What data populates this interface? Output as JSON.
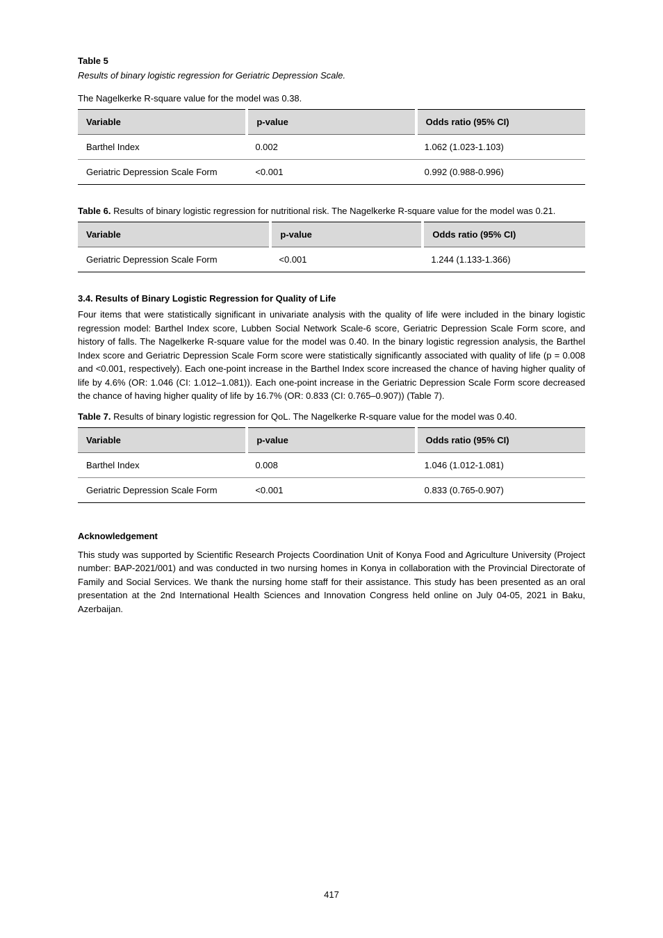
{
  "header": {
    "title": "Table 5",
    "subtitle": "Results of binary logistic regression for Geriatric Depression Scale.",
    "intro": "The Nagelkerke R-square value for the model was 0.38."
  },
  "table5": {
    "headers": [
      "Variable",
      "p-value",
      "Odds ratio (95% CI)"
    ],
    "rows": [
      [
        "Barthel Index",
        "0.002",
        "1.062 (1.023-1.103)"
      ],
      [
        "Geriatric Depression Scale Form",
        "<0.001",
        "0.992 (0.988-0.996)"
      ]
    ]
  },
  "table6": {
    "caption_label": "Table 6.",
    "caption_text": " Results of binary logistic regression for nutritional risk. The Nagelkerke R-square value for the model was 0.21.",
    "headers": [
      "Variable",
      "p-value",
      "Odds ratio (95% CI)"
    ],
    "rows": [
      [
        "Geriatric Depression Scale Form",
        "<0.001",
        "1.244 (1.133-1.366)"
      ]
    ]
  },
  "section": {
    "heading": "3.4. Results of Binary Logistic Regression for Quality of Life",
    "para1": "Four items that were statistically significant in univariate analysis with the quality of life were included in the binary logistic regression model: Barthel Index score, Lubben Social Network Scale-6 score, Geriatric Depression Scale Form score, and history of falls. The Nagelkerke R-square value for the model was 0.40. In the binary logistic regression analysis, the Barthel Index score and Geriatric Depression Scale Form score were statistically significantly associated with quality of life (p = 0.008 and <0.001, respectively). Each one-point increase in the Barthel Index score increased the chance of having higher quality of life by 4.6% (OR: 1.046 (CI: 1.012–1.081)). Each one-point increase in the Geriatric Depression Scale Form score decreased the chance of having higher quality of life by 16.7% (OR: 0.833 (CI: 0.765–0.907)) (Table 7)."
  },
  "table7": {
    "caption_label": "Table 7.",
    "caption_text": " Results of binary logistic regression for QoL. The Nagelkerke R-square value for the model was 0.40.",
    "headers": [
      "Variable",
      "p-value",
      "Odds ratio (95% CI)"
    ],
    "rows": [
      [
        "Barthel Index",
        "0.008",
        "1.046 (1.012-1.081)"
      ],
      [
        "Geriatric Depression Scale Form",
        "<0.001",
        "0.833 (0.765-0.907)"
      ]
    ]
  },
  "ack": {
    "heading": "Acknowledgement",
    "body": "This study was supported by Scientific Research Projects Coordination Unit of Konya Food and Agriculture University (Project number: BAP-2021/001) and was conducted in two nursing homes in Konya in collaboration with the Provincial Directorate of Family and Social Services. We thank the nursing home staff for their assistance. This study has been presented as an oral presentation at the 2nd International Health Sciences and Innovation Congress held online on July 04-05, 2021 in Baku, Azerbaijan."
  },
  "page_number": "417"
}
